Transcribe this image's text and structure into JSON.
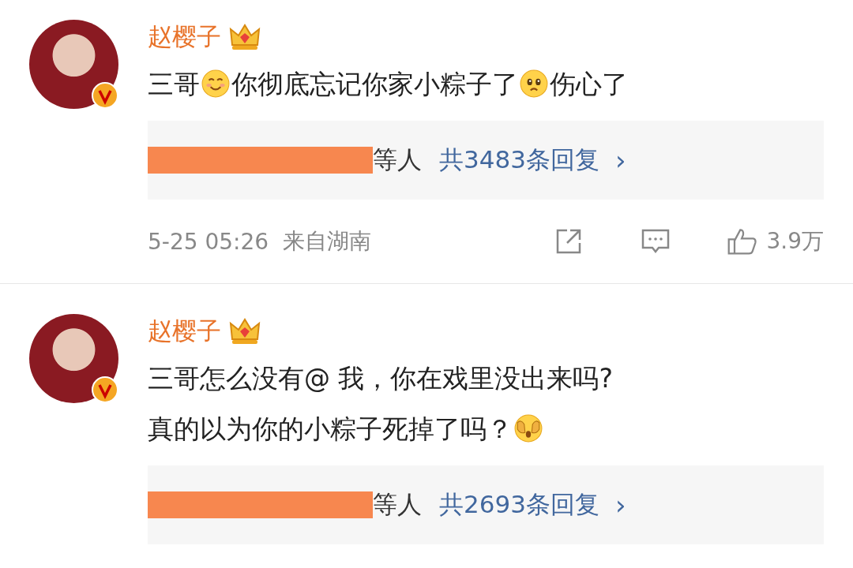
{
  "comments": [
    {
      "name": "赵樱子",
      "verified": true,
      "vip": true,
      "segments": [
        {
          "kind": "text",
          "text": "三哥"
        },
        {
          "kind": "smile"
        },
        {
          "kind": "text",
          "text": "你彻底忘记你家小粽子了"
        },
        {
          "kind": "sad"
        },
        {
          "kind": "text",
          "text": "伤心了"
        }
      ],
      "replies": {
        "redacted": true,
        "suffix": "等人",
        "count": "共3483条回复",
        "chevron": "›"
      },
      "footer": {
        "time": "5-25 05:26",
        "location": "来自湖南",
        "likes": "3.9万"
      }
    },
    {
      "name": "赵樱子",
      "verified": true,
      "vip": true,
      "segments": [
        {
          "kind": "text",
          "text": "三哥怎么没有@ 我，你在戏里没出来吗?"
        },
        {
          "kind": "break"
        },
        {
          "kind": "text",
          "text": "真的以为你的小粽子死掉了吗？"
        },
        {
          "kind": "shy"
        }
      ],
      "replies": {
        "redacted": true,
        "suffix": "等人",
        "count": "共2693条回复",
        "chevron": "›"
      }
    }
  ]
}
